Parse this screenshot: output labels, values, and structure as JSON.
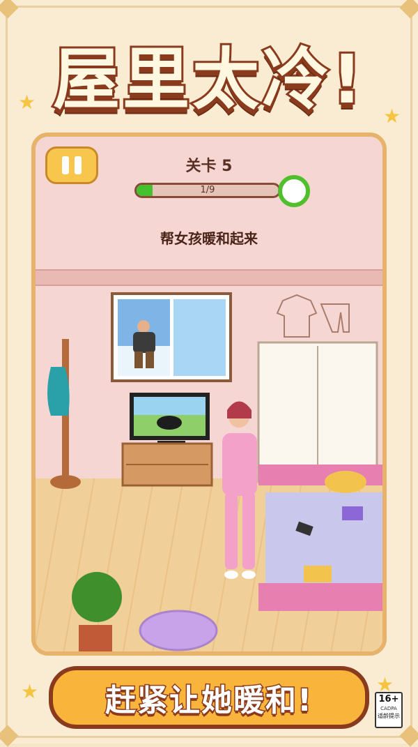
{
  "title": "屋里太冷!",
  "hud": {
    "level_label": "关卡 5",
    "progress_text": "1/9",
    "progress_fraction": 0.111,
    "instruction": "帮女孩暖和起来"
  },
  "banner": {
    "text": "赶紧让她暖和!"
  },
  "age_rating": {
    "rating": "16+",
    "org": "CADPA",
    "tip": "适龄提示"
  },
  "colors": {
    "accent": "#f9b43c",
    "outline": "#8a3a1d",
    "progress": "#43c12e"
  }
}
